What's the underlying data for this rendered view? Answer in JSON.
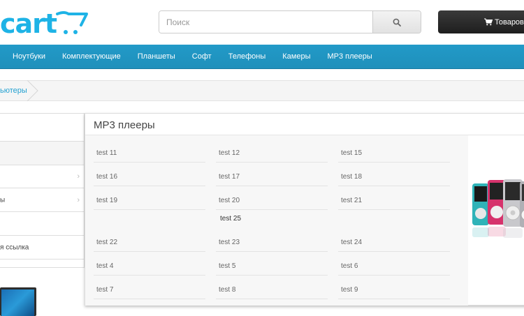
{
  "header": {
    "logo_text": "cart",
    "search_placeholder": "Поиск",
    "cart_label": "Товаров"
  },
  "menu": {
    "items": [
      "Ноутбуки",
      "Комплектующие",
      "Планшеты",
      "Софт",
      "Телефоны",
      "Камеры",
      "MP3 плееры"
    ]
  },
  "breadcrumb": {
    "items": [
      "ьютеры"
    ]
  },
  "sidebar": {
    "items": [
      "ы",
      "я ссылка"
    ]
  },
  "dropdown": {
    "title": "MP3 плееры",
    "rows": [
      [
        "test 11",
        "test 12",
        "test 15"
      ],
      [
        "test 16",
        "test 17",
        "test 18"
      ],
      [
        "test 19",
        "test 20",
        "test 21"
      ],
      [
        "",
        "test 25",
        ""
      ],
      [
        "test 22",
        "test 23",
        "test 24"
      ],
      [
        "test 4",
        "test 5",
        "test 6"
      ],
      [
        "test 7",
        "test 8",
        "test 9"
      ]
    ]
  },
  "colors": {
    "brand": "#1eb3e6",
    "menu_bar": "#229ac8",
    "cart_button": "#2a2a2a"
  },
  "icons": {
    "search": "search-icon",
    "cart": "shopping-cart-icon",
    "chevron": "chevron-right-icon"
  }
}
